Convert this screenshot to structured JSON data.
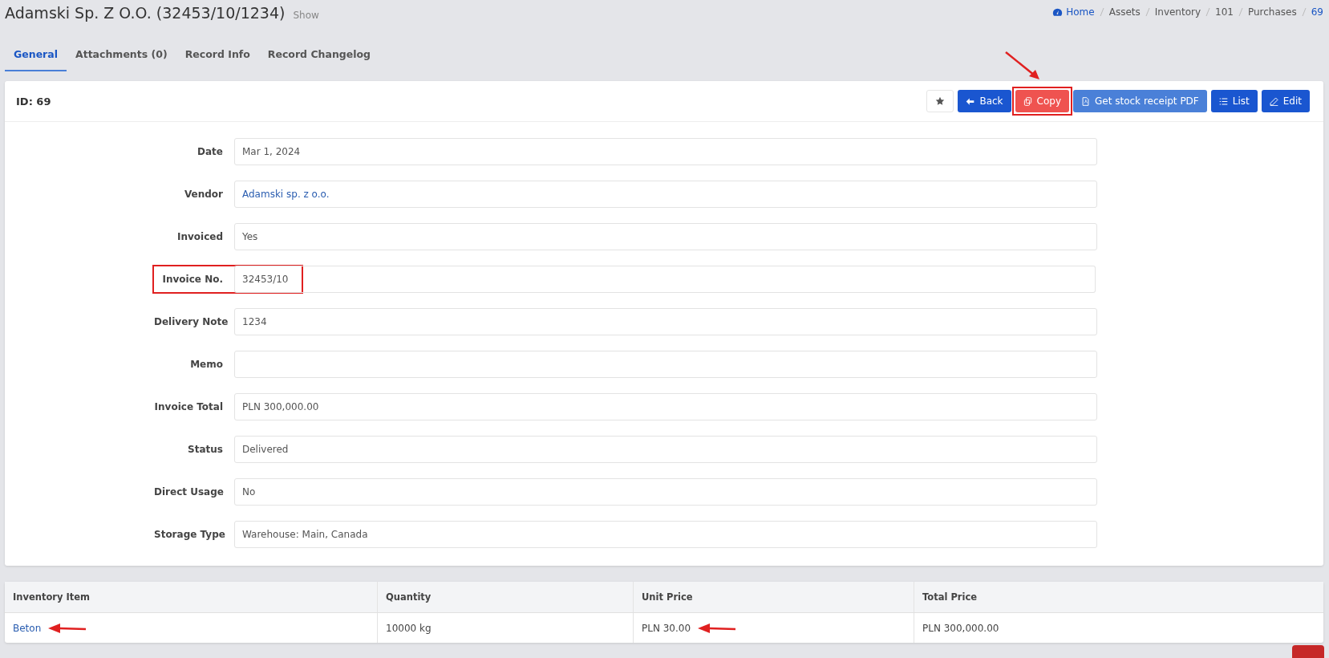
{
  "page": {
    "title": "Adamski Sp. Z O.O. (32453/10/1234)",
    "subtitle": "Show"
  },
  "breadcrumb": [
    {
      "label": "Home",
      "link": true
    },
    {
      "label": "Assets",
      "link": false
    },
    {
      "label": "Inventory",
      "link": false
    },
    {
      "label": "101",
      "link": false
    },
    {
      "label": "Purchases",
      "link": false
    },
    {
      "label": "69",
      "link": true
    }
  ],
  "tabs": [
    {
      "label": "General",
      "selected": true
    },
    {
      "label": "Attachments (0)",
      "selected": false
    },
    {
      "label": "Record Info",
      "selected": false
    },
    {
      "label": "Record Changelog",
      "selected": false
    }
  ],
  "record": {
    "id_label": "ID: 69"
  },
  "actions": [
    {
      "kind": "star",
      "highlighted": false
    },
    {
      "kind": "back",
      "label": "Back",
      "highlighted": false
    },
    {
      "kind": "copy",
      "label": "Copy",
      "highlighted": true
    },
    {
      "kind": "pdf",
      "label": "Get stock receipt PDF",
      "highlighted": false
    },
    {
      "kind": "list",
      "label": "List",
      "highlighted": false
    },
    {
      "kind": "edit",
      "label": "Edit",
      "highlighted": false
    }
  ],
  "fields": [
    {
      "label": "Date",
      "value": "Mar 1, 2024",
      "link": false,
      "highlighted": false
    },
    {
      "label": "Vendor",
      "value": "Adamski sp. z o.o.",
      "link": true,
      "highlighted": false
    },
    {
      "label": "Invoiced",
      "value": "Yes",
      "link": false,
      "highlighted": false
    },
    {
      "label": "Invoice No.",
      "value": "32453/10",
      "link": false,
      "highlighted": true
    },
    {
      "label": "Delivery Note",
      "value": "1234",
      "link": false,
      "highlighted": false
    },
    {
      "label": "Memo",
      "highlighted": false
    },
    {
      "label": "Invoice Total",
      "value": "PLN 300,000.00",
      "link": false,
      "highlighted": false
    },
    {
      "label": "Status",
      "value": "Delivered",
      "link": false,
      "highlighted": false
    },
    {
      "label": "Direct Usage",
      "value": "No",
      "link": false,
      "highlighted": false
    },
    {
      "label": "Storage Type",
      "value": "Warehouse: Main, Canada",
      "link": false,
      "highlighted": false
    }
  ],
  "table": {
    "columns": [
      "Inventory Item",
      "Quantity",
      "Unit Price",
      "Total Price"
    ],
    "rows": [
      {
        "cells": [
          {
            "text": "Beton",
            "link": true,
            "arrow": true
          },
          {
            "text": "10000 kg",
            "link": false,
            "arrow": false
          },
          {
            "text": "PLN 30.00",
            "link": false,
            "arrow": true
          },
          {
            "text": "PLN 300,000.00",
            "link": false,
            "arrow": false
          }
        ]
      }
    ]
  }
}
